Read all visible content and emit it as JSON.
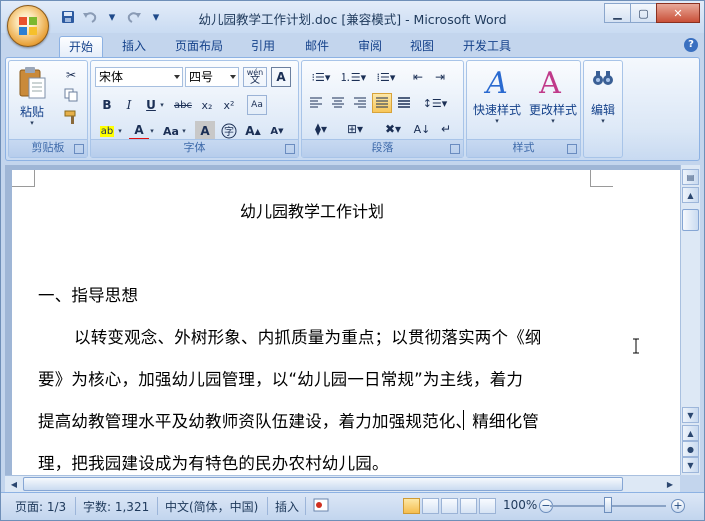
{
  "window": {
    "title": "幼儿园教学工作计划.doc [兼容模式] - Microsoft Word",
    "controls": [
      "minimize-icon",
      "maximize-icon",
      "close-icon"
    ]
  },
  "qat": {
    "items": [
      "save-icon",
      "undo-icon",
      "redo-icon",
      "customize-icon"
    ]
  },
  "tabs": [
    {
      "label": "开始",
      "active": true
    },
    {
      "label": "插入"
    },
    {
      "label": "页面布局"
    },
    {
      "label": "引用"
    },
    {
      "label": "邮件"
    },
    {
      "label": "审阅"
    },
    {
      "label": "视图"
    },
    {
      "label": "开发工具"
    }
  ],
  "ribbon": {
    "clipboard": {
      "label": "剪贴板",
      "paste": "粘贴"
    },
    "font": {
      "label": "字体",
      "font_name": "宋体",
      "font_size": "四号",
      "wen": "wén",
      "a_box": "A"
    },
    "paragraph": {
      "label": "段落"
    },
    "styles": {
      "label": "样式",
      "quick_styles": "快速样式",
      "change_styles": "更改样式"
    },
    "editing": {
      "label": "编辑",
      "edit": "编辑"
    },
    "accent_color": "#15428b"
  },
  "document": {
    "title": "幼儿园教学工作计划",
    "heading": "一、指导思想",
    "lines": [
      "以转变观念、外树形象、内抓质量为重点；以贯彻落实两个《纲",
      "要》为核心，加强幼儿园管理，以“幼儿园一日常规”为主线，着力",
      "提高幼教管理水平及幼教师资队伍建设，着力加强规范化、精细化管",
      "理，把我园建设成为有特色的民办农村幼儿园。"
    ]
  },
  "status": {
    "page": "页面: 1/3",
    "words": "字数: 1,321",
    "language": "中文(简体，中国)",
    "mode": "插入",
    "zoom": "100%",
    "zoom_level": 1.0
  }
}
